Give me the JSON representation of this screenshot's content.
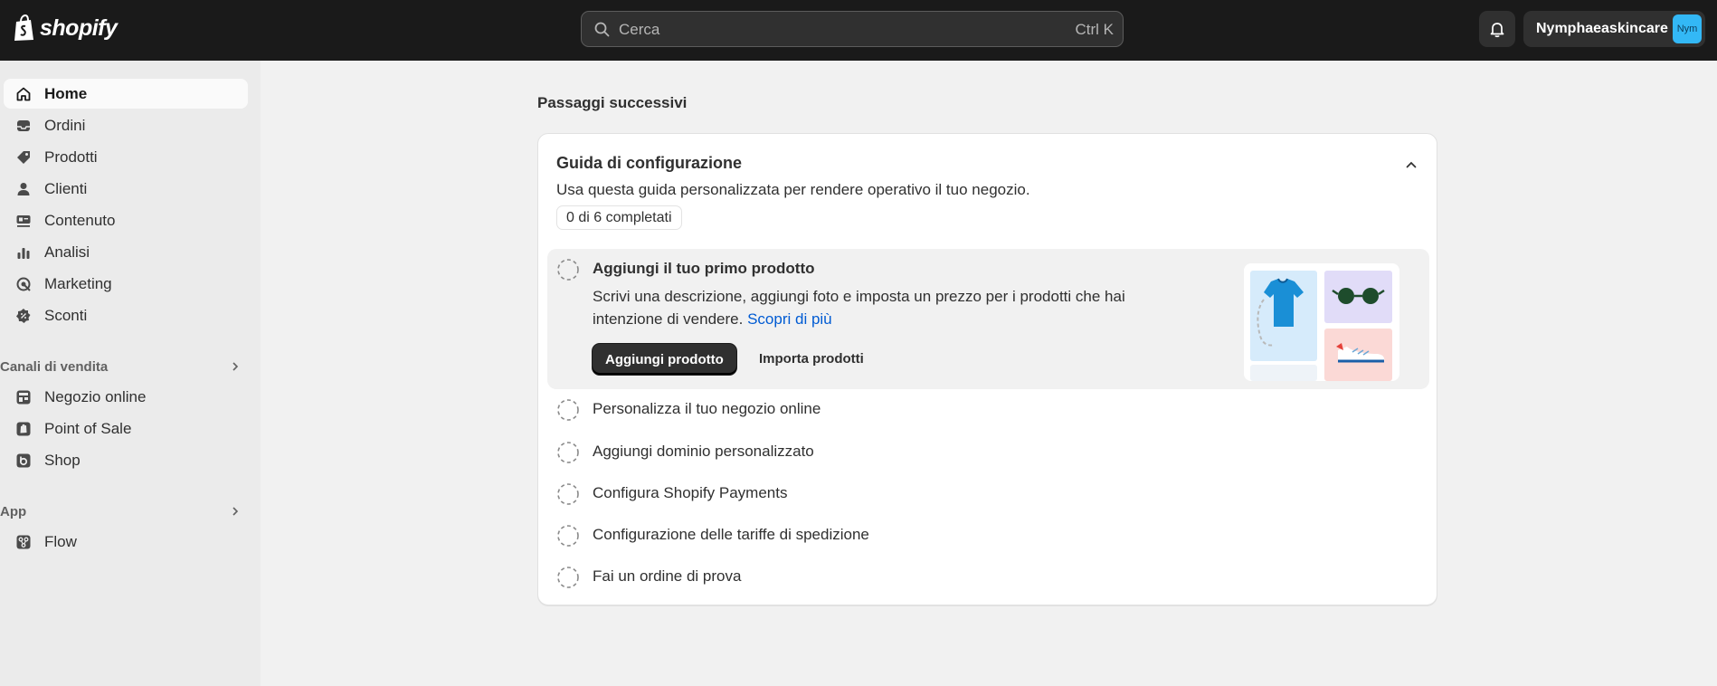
{
  "header": {
    "logo_text": "shopify",
    "search_placeholder": "Cerca",
    "search_shortcut": "Ctrl K",
    "store_name": "Nymphaeaskincare",
    "avatar_initials": "Nym"
  },
  "sidebar": {
    "items": [
      {
        "label": "Home",
        "icon": "home-icon"
      },
      {
        "label": "Ordini",
        "icon": "inbox-icon"
      },
      {
        "label": "Prodotti",
        "icon": "tag-icon"
      },
      {
        "label": "Clienti",
        "icon": "person-icon"
      },
      {
        "label": "Contenuto",
        "icon": "content-icon"
      },
      {
        "label": "Analisi",
        "icon": "bar-chart-icon"
      },
      {
        "label": "Marketing",
        "icon": "target-icon"
      },
      {
        "label": "Sconti",
        "icon": "discount-icon"
      }
    ],
    "sales_channels_label": "Canali di vendita",
    "sales_channels": [
      {
        "label": "Negozio online",
        "icon": "store-icon"
      },
      {
        "label": "Point of Sale",
        "icon": "pos-icon"
      },
      {
        "label": "Shop",
        "icon": "shop-icon"
      }
    ],
    "apps_label": "App",
    "apps": [
      {
        "label": "Flow",
        "icon": "flow-icon"
      }
    ]
  },
  "main": {
    "section_title": "Passaggi successivi",
    "guide": {
      "title": "Guida di configurazione",
      "subtitle": "Usa questa guida personalizzata per rendere operativo il tuo negozio.",
      "progress": "0 di 6 completati",
      "open_task": {
        "title": "Aggiungi il tuo primo prodotto",
        "description": "Scrivi una descrizione, aggiungi foto e imposta un prezzo per i prodotti che hai intenzione di vendere.",
        "link": "Scopri di più",
        "primary_button": "Aggiungi prodotto",
        "secondary_button": "Importa prodotti"
      },
      "tasks": [
        "Personalizza il tuo negozio online",
        "Aggiungi dominio personalizzato",
        "Configura Shopify Payments",
        "Configurazione delle tariffe di spedizione",
        "Fai un ordine di prova"
      ]
    }
  },
  "colors": {
    "topbar": "#1a1a1a",
    "sidebar": "#ebebeb",
    "page": "#f1f1f1",
    "link": "#005bd3",
    "avatar": "#33b8f6"
  }
}
